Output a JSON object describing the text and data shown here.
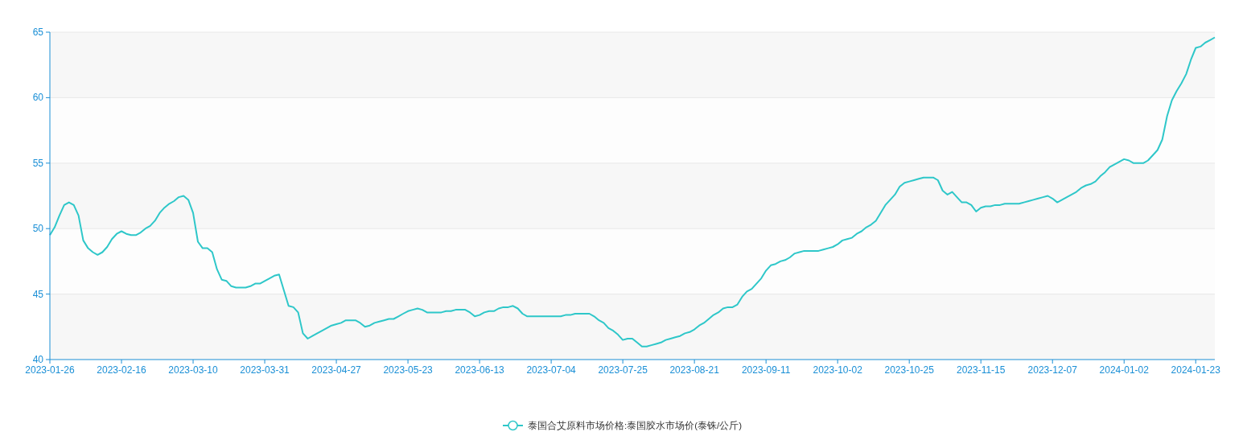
{
  "chart": {
    "chart_data": {
      "type": "line",
      "grid": true,
      "ylim": [
        40,
        65
      ],
      "yticks": [
        40,
        45,
        50,
        55,
        60,
        65
      ],
      "categories": [
        "2023-01-26",
        null,
        null,
        null,
        null,
        null,
        null,
        null,
        null,
        null,
        null,
        null,
        null,
        null,
        null,
        "2023-02-16",
        null,
        null,
        null,
        null,
        null,
        null,
        null,
        null,
        null,
        null,
        null,
        null,
        null,
        null,
        "2023-03-10",
        null,
        null,
        null,
        null,
        null,
        null,
        null,
        null,
        null,
        null,
        null,
        null,
        null,
        null,
        "2023-03-31",
        null,
        null,
        null,
        null,
        null,
        null,
        null,
        null,
        null,
        null,
        null,
        null,
        null,
        null,
        "2023-04-27",
        null,
        null,
        null,
        null,
        null,
        null,
        null,
        null,
        null,
        null,
        null,
        null,
        null,
        null,
        "2023-05-23",
        null,
        null,
        null,
        null,
        null,
        null,
        null,
        null,
        null,
        null,
        null,
        null,
        null,
        null,
        "2023-06-13",
        null,
        null,
        null,
        null,
        null,
        null,
        null,
        null,
        null,
        null,
        null,
        null,
        null,
        null,
        "2023-07-04",
        null,
        null,
        null,
        null,
        null,
        null,
        null,
        null,
        null,
        null,
        null,
        null,
        null,
        null,
        "2023-07-25",
        null,
        null,
        null,
        null,
        null,
        null,
        null,
        null,
        null,
        null,
        null,
        null,
        null,
        null,
        "2023-08-21",
        null,
        null,
        null,
        null,
        null,
        null,
        null,
        null,
        null,
        null,
        null,
        null,
        null,
        null,
        "2023-09-11",
        null,
        null,
        null,
        null,
        null,
        null,
        null,
        null,
        null,
        null,
        null,
        null,
        null,
        null,
        "2023-10-02",
        null,
        null,
        null,
        null,
        null,
        null,
        null,
        null,
        null,
        null,
        null,
        null,
        null,
        null,
        "2023-10-25",
        null,
        null,
        null,
        null,
        null,
        null,
        null,
        null,
        null,
        null,
        null,
        null,
        null,
        null,
        "2023-11-15",
        null,
        null,
        null,
        null,
        null,
        null,
        null,
        null,
        null,
        null,
        null,
        null,
        null,
        null,
        "2023-12-07",
        null,
        null,
        null,
        null,
        null,
        null,
        null,
        null,
        null,
        null,
        null,
        null,
        null,
        null,
        "2024-01-02",
        null,
        null,
        null,
        null,
        null,
        null,
        null,
        null,
        null,
        null,
        null,
        null,
        null,
        null,
        "2024-01-23",
        null,
        null,
        null,
        null
      ],
      "series": [
        {
          "name": "泰国合艾原料市场价格:泰国胶水市场价(泰铢/公斤)",
          "color": "#2ec7c9",
          "values": [
            49.5,
            50.1,
            51.0,
            51.8,
            52,
            51.8,
            51.0,
            49.1,
            48.5,
            48.2,
            48,
            48.2,
            48.6,
            49.2,
            49.6,
            49.8,
            49.6,
            49.5,
            49.5,
            49.7,
            50.0,
            50.2,
            50.6,
            51.2,
            51.6,
            51.9,
            52.1,
            52.4,
            52.5,
            52.2,
            51.2,
            49.0,
            48.5,
            48.5,
            48.2,
            46.9,
            46.1,
            46,
            45.6,
            45.5,
            45.5,
            45.5,
            45.6,
            45.8,
            45.8,
            46.0,
            46.2,
            46.4,
            46.5,
            45.3,
            44.1,
            44,
            43.6,
            42.0,
            41.6,
            41.8,
            42.0,
            42.2,
            42.4,
            42.6,
            42.7,
            42.8,
            43,
            43,
            43,
            42.8,
            42.5,
            42.6,
            42.8,
            42.9,
            43.0,
            43.1,
            43.1,
            43.3,
            43.5,
            43.7,
            43.8,
            43.9,
            43.8,
            43.6,
            43.6,
            43.6,
            43.6,
            43.7,
            43.7,
            43.8,
            43.8,
            43.8,
            43.6,
            43.3,
            43.4,
            43.6,
            43.7,
            43.7,
            43.9,
            44,
            44,
            44.1,
            43.9,
            43.5,
            43.3,
            43.3,
            43.3,
            43.3,
            43.3,
            43.3,
            43.3,
            43.3,
            43.4,
            43.4,
            43.5,
            43.5,
            43.5,
            43.5,
            43.3,
            43,
            42.8,
            42.4,
            42.2,
            41.9,
            41.5,
            41.6,
            41.6,
            41.3,
            41,
            41,
            41.1,
            41.2,
            41.3,
            41.5,
            41.6,
            41.7,
            41.8,
            42.0,
            42.1,
            42.3,
            42.6,
            42.8,
            43.1,
            43.4,
            43.6,
            43.9,
            44.0,
            44.0,
            44.2,
            44.8,
            45.2,
            45.4,
            45.8,
            46.2,
            46.8,
            47.2,
            47.3,
            47.5,
            47.6,
            47.8,
            48.1,
            48.2,
            48.3,
            48.3,
            48.3,
            48.3,
            48.4,
            48.5,
            48.6,
            48.8,
            49.1,
            49.2,
            49.3,
            49.6,
            49.8,
            50.1,
            50.3,
            50.6,
            51.2,
            51.8,
            52.2,
            52.6,
            53.2,
            53.5,
            53.6,
            53.7,
            53.8,
            53.9,
            53.9,
            53.9,
            53.7,
            52.9,
            52.6,
            52.8,
            52.4,
            52,
            52.0,
            51.8,
            51.3,
            51.6,
            51.7,
            51.7,
            51.8,
            51.8,
            51.9,
            51.9,
            51.9,
            51.9,
            52.0,
            52.1,
            52.2,
            52.3,
            52.4,
            52.5,
            52.3,
            52,
            52.2,
            52.4,
            52.6,
            52.8,
            53.1,
            53.3,
            53.4,
            53.6,
            54.0,
            54.3,
            54.7,
            54.9,
            55.1,
            55.3,
            55.2,
            55,
            55,
            55,
            55.2,
            55.6,
            56.0,
            56.8,
            58.6,
            59.8,
            60.5,
            61.1,
            61.8,
            62.9,
            63.8,
            63.9,
            64.2,
            64.4,
            64.6
          ]
        }
      ]
    }
  }
}
